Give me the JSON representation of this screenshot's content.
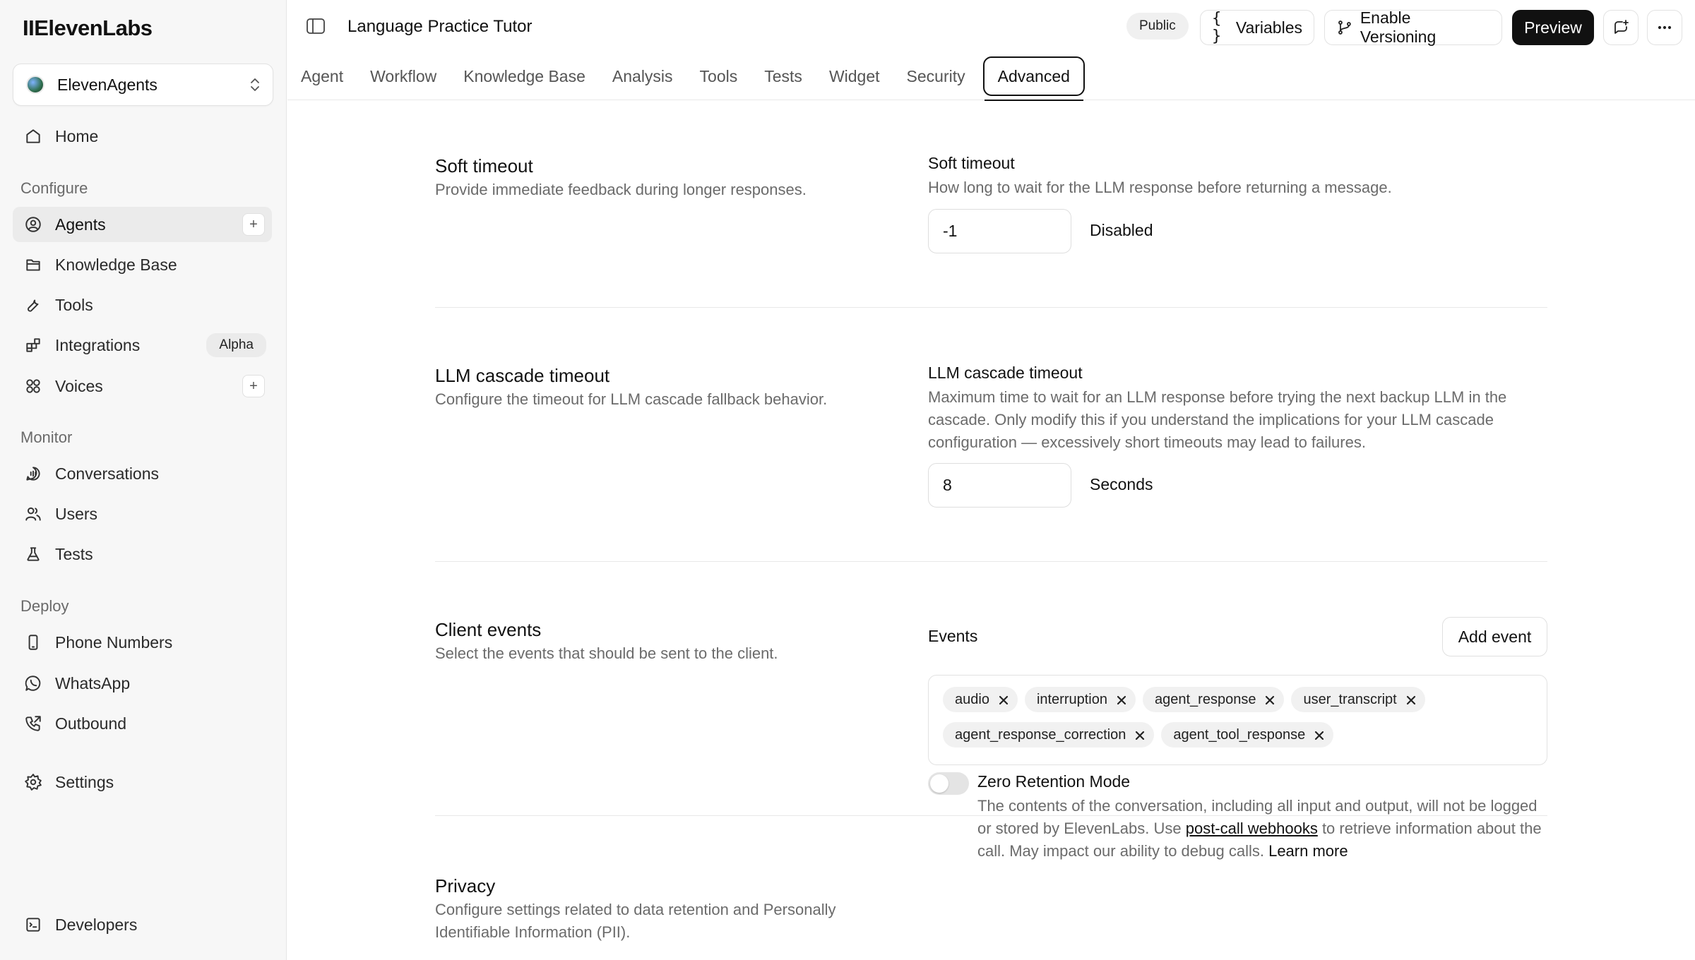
{
  "sidebar": {
    "logo": "IIElevenLabs",
    "workspace": "ElevenAgents",
    "home": "Home",
    "configure_label": "Configure",
    "agents": "Agents",
    "knowledge_base": "Knowledge Base",
    "tools": "Tools",
    "integrations": "Integrations",
    "integrations_badge": "Alpha",
    "voices": "Voices",
    "monitor_label": "Monitor",
    "conversations": "Conversations",
    "users": "Users",
    "tests": "Tests",
    "deploy_label": "Deploy",
    "phone_numbers": "Phone Numbers",
    "whatsapp": "WhatsApp",
    "outbound": "Outbound",
    "settings": "Settings",
    "developers": "Developers",
    "plus": "+"
  },
  "header": {
    "title": "Language Practice Tutor",
    "visibility": "Public",
    "variables": "Variables",
    "versioning": "Enable Versioning",
    "preview": "Preview"
  },
  "tabs": [
    "Agent",
    "Workflow",
    "Knowledge Base",
    "Analysis",
    "Tools",
    "Tests",
    "Widget",
    "Security",
    "Advanced"
  ],
  "soft_timeout": {
    "title": "Soft timeout",
    "desc": "Provide immediate feedback during longer responses.",
    "field_label": "Soft timeout",
    "field_help": "How long to wait for the LLM response before returning a message.",
    "value": "-1",
    "unit": "Disabled"
  },
  "cascade": {
    "title": "LLM cascade timeout",
    "desc": "Configure the timeout for LLM cascade fallback behavior.",
    "field_label": "LLM cascade timeout",
    "field_help": "Maximum time to wait for an LLM response before trying the next backup LLM in the cascade. Only modify this if you understand the implications for your LLM cascade configuration — excessively short timeouts may lead to failures.",
    "value": "8",
    "unit": "Seconds"
  },
  "client_events": {
    "title": "Client events",
    "desc": "Select the events that should be sent to the client.",
    "field_label": "Events",
    "add_button": "Add event",
    "events": [
      "audio",
      "interruption",
      "agent_response",
      "user_transcript",
      "agent_response_correction",
      "agent_tool_response"
    ]
  },
  "privacy": {
    "title": "Privacy",
    "desc": "Configure settings related to data retention and Personally Identifiable Information (PII).",
    "zero_retention_label": "Zero Retention Mode",
    "zero_retention_enabled": false,
    "help_part1": "The contents of the conversation, including all input and output, will not be logged or stored by ElevenLabs. Use ",
    "help_link": "post-call webhooks",
    "help_part2": " to retrieve information about the call. May impact our ability to debug calls. ",
    "learn_more": "Learn more"
  }
}
